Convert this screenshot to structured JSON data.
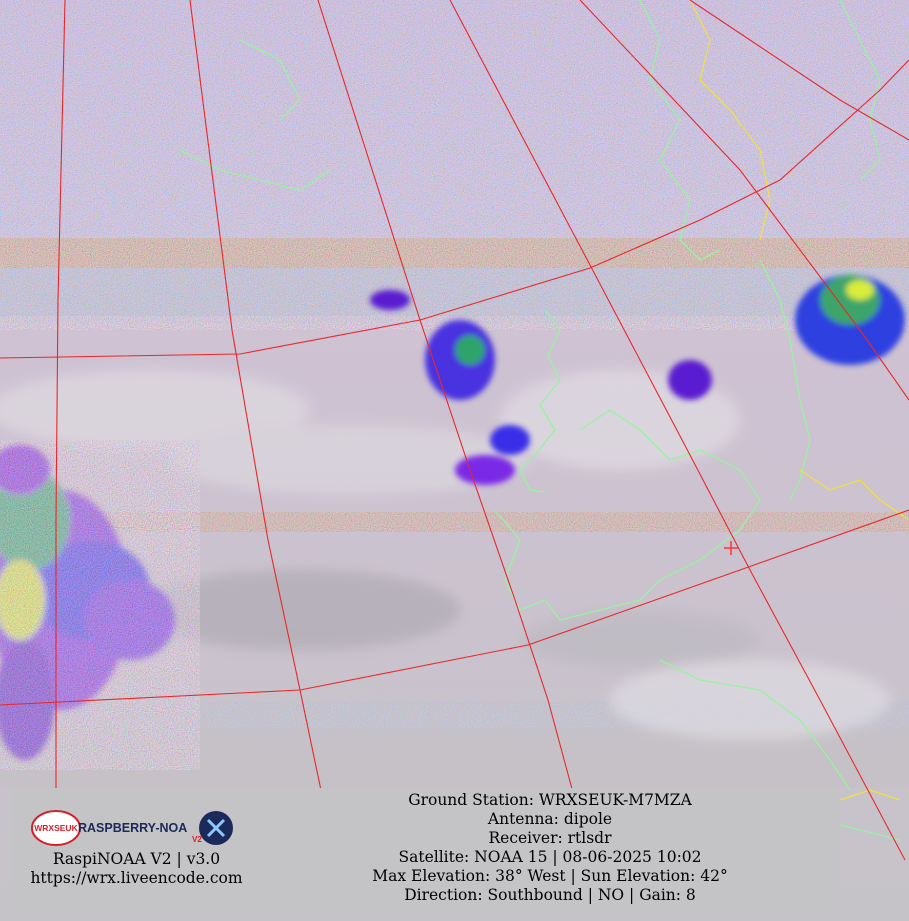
{
  "logo": {
    "badge_text": "WRXSEUK",
    "wordmark": "RASPBERRY-NOA",
    "wordmark_suffix": "V2",
    "colors": {
      "red": "#d6202a",
      "navy": "#1c2a5a",
      "accent": "#e31b23"
    }
  },
  "credits": {
    "version": "RaspiNOAA V2 | v3.0",
    "url": "https://wrx.liveencode.com"
  },
  "pass_info": {
    "ground_station": "Ground Station: WRXSEUK-M7MZA",
    "antenna": "Antenna: dipole",
    "receiver": "Receiver: rtlsdr",
    "satellite": "Satellite: NOAA 15 | 08-06-2025 10:02",
    "elevation": "Max Elevation: 38° West | Sun Elevation: 42°",
    "direction": "Direction: Southbound | NO | Gain: 8"
  },
  "map_style": {
    "graticule_color": "#e8282a",
    "coastline_color": "#98f2a0",
    "border_color": "#f1e23a",
    "station_marker_color": "#ff3c3c"
  }
}
